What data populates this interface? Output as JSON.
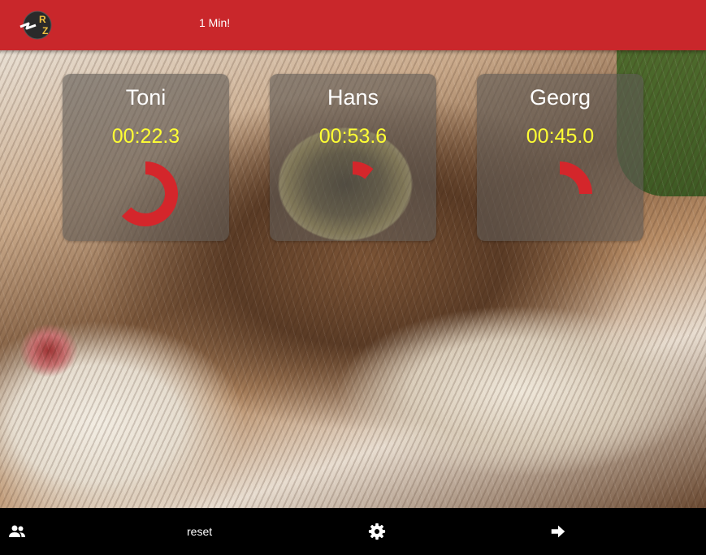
{
  "header": {
    "title": "1 Min!",
    "logo_letters": [
      "R",
      "Z"
    ]
  },
  "players": [
    {
      "name": "Toni",
      "time": "00:22.3",
      "elapsed_fraction": 0.63
    },
    {
      "name": "Hans",
      "time": "00:53.6",
      "elapsed_fraction": 0.11
    },
    {
      "name": "Georg",
      "time": "00:45.0",
      "elapsed_fraction": 0.25
    }
  ],
  "footer": {
    "players_icon": "people-icon",
    "reset_label": "reset",
    "settings_icon": "gear-icon",
    "next_icon": "arrow-right-icon"
  },
  "colors": {
    "header": "#c9272b",
    "timer_text": "#ffff33",
    "progress": "#d4262b",
    "footer": "#000000"
  }
}
